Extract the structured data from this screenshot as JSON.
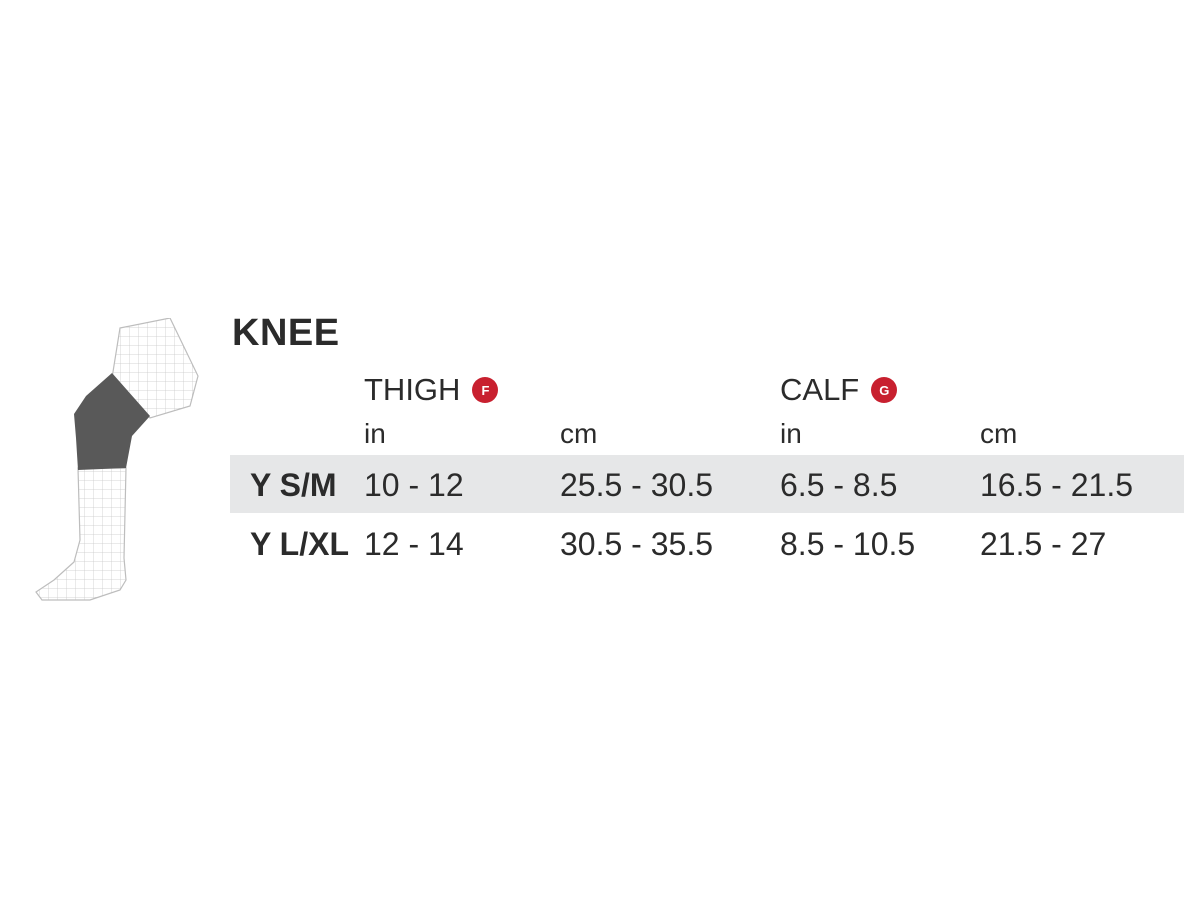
{
  "title": "KNEE",
  "groups": [
    {
      "label": "THIGH",
      "badge": "F"
    },
    {
      "label": "CALF",
      "badge": "G"
    }
  ],
  "units": [
    "in",
    "cm",
    "in",
    "cm"
  ],
  "rows": [
    {
      "size": "Y S/M",
      "values": [
        "10 - 12",
        "25.5 - 30.5",
        "6.5 - 8.5",
        "16.5 - 21.5"
      ]
    },
    {
      "size": "Y L/XL",
      "values": [
        "12 - 14",
        "30.5 - 35.5",
        "8.5 - 10.5",
        "21.5 - 27"
      ]
    }
  ],
  "colors": {
    "badge": "#c8202f",
    "highlight_row": "#e6e7e8",
    "sleeve": "#595959",
    "text": "#2b2b2b"
  },
  "illustration": "leg-with-knee-sleeve-icon"
}
